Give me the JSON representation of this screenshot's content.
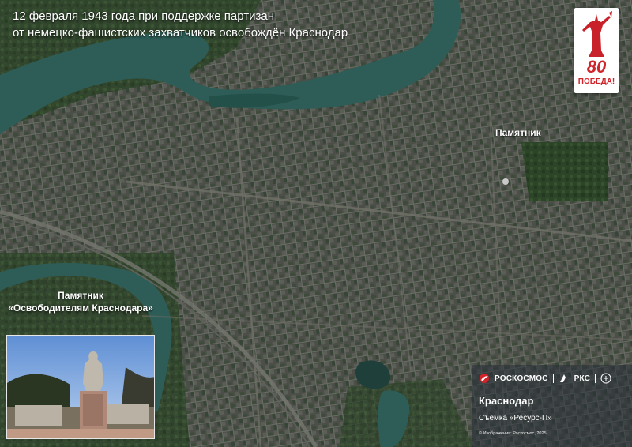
{
  "title": {
    "line1": "12 февраля 1943 года при поддержке партизан",
    "line2": "от немецко-фашистских захватчиков освобождён Краснодар"
  },
  "labels": {
    "monument": "Памятник"
  },
  "badge": {
    "number": "80",
    "word": "ПОБЕДА!",
    "color": "#d0242b"
  },
  "inset": {
    "title_line1": "Памятник",
    "title_line2": "«Освободителям Краснодара»"
  },
  "info": {
    "logo_roscosmos": "РОСКОСМОС",
    "logo_rks": "РКС",
    "city": "Краснодар",
    "shooting": "Съемка «Ресурс-П»",
    "copyright": "© Изображения: Роскосмос, 2025"
  },
  "colors": {
    "river": "#2e5d57",
    "city": "#4a4e47",
    "vegetation": "#2f4a2c"
  }
}
